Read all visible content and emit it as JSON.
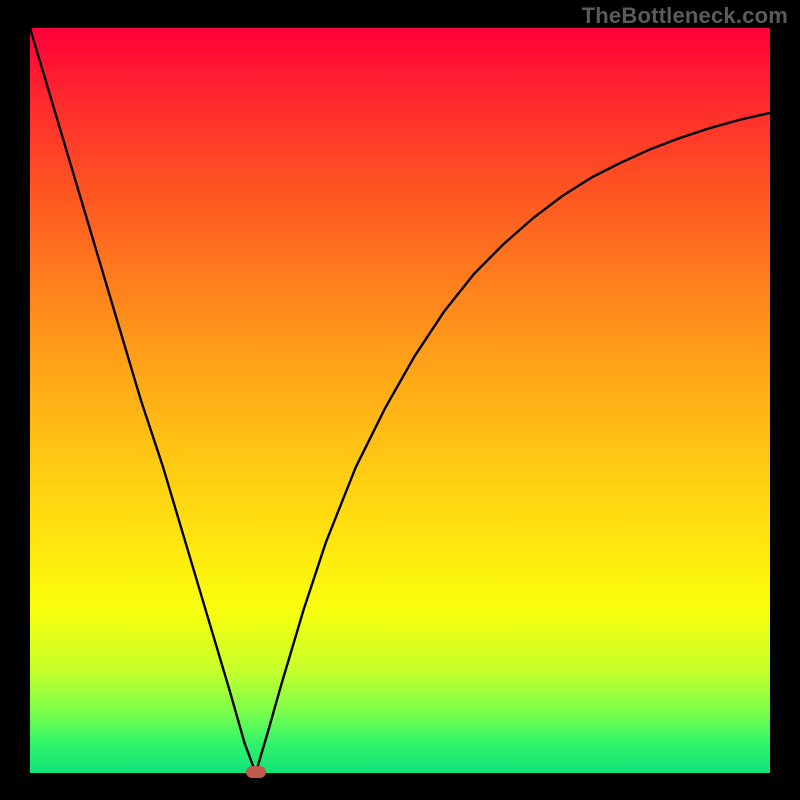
{
  "watermark": "TheBottleneck.com",
  "colors": {
    "curve": "#000000",
    "marker": "#c05a4c"
  },
  "chart_data": {
    "type": "line",
    "title": "",
    "xlabel": "",
    "ylabel": "",
    "xlim": [
      0,
      100
    ],
    "ylim": [
      0,
      100
    ],
    "grid": false,
    "legend": false,
    "min_point": {
      "x": 30.5,
      "y": 0
    },
    "series": [
      {
        "name": "curve",
        "x": [
          0,
          3,
          6,
          9,
          12,
          15,
          18,
          21,
          24,
          27,
          29,
          30.5,
          32,
          34,
          37,
          40,
          44,
          48,
          52,
          56,
          60,
          64,
          68,
          72,
          76,
          80,
          84,
          88,
          92,
          96,
          100
        ],
        "y": [
          100,
          90,
          80,
          70,
          60,
          50,
          41,
          31,
          21,
          11,
          4,
          0,
          5,
          12,
          22,
          31,
          41,
          49,
          56,
          62,
          67,
          71,
          74.5,
          77.5,
          80,
          82,
          83.8,
          85.3,
          86.6,
          87.7,
          88.6
        ]
      }
    ]
  }
}
